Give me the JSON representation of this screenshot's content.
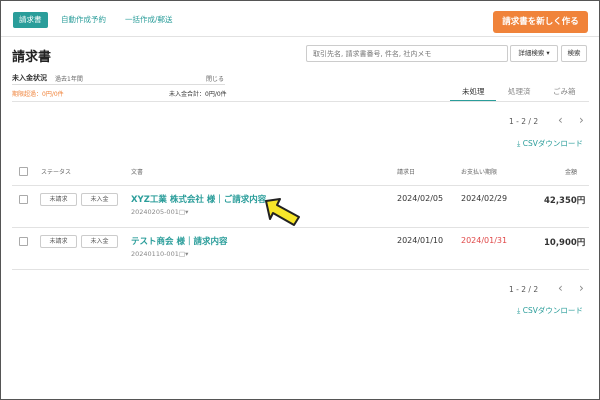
{
  "tabs": [
    {
      "label": "請求書"
    },
    {
      "label": "自動作成予約"
    },
    {
      "label": "一括作成/郵送"
    }
  ],
  "primary_button": "請求書を新しく作る",
  "page_title": "請求書",
  "search": {
    "placeholder": "取引先名, 請求書番号, 件名, 社内メモ",
    "detail_button": "詳細検索",
    "detail_caret": "▾",
    "search_button": "検索"
  },
  "unpaid_status": {
    "label": "未入金状況",
    "period": "過去1年間",
    "close_label": "閉じる",
    "overdue": "期限超過：0円/0件",
    "unpaid_total": "未入金合計：0円/0件"
  },
  "filter_tabs": [
    {
      "label": "未処理"
    },
    {
      "label": "処理済"
    },
    {
      "label": "ごみ箱"
    }
  ],
  "pagination": {
    "label": "1 - 2 / 2",
    "prev": "‹",
    "next": "›"
  },
  "csv_download": {
    "icon": "⤓",
    "label": "CSVダウンロード"
  },
  "table": {
    "headers": {
      "status": "ステータス",
      "document": "文書",
      "invoice_date": "請求日",
      "due_date": "お支払い期限",
      "amount": "金額"
    },
    "rows": [
      {
        "status1": "未請求",
        "status2": "未入金",
        "title": "XYZ工業 株式会社 様｜ご請求内容",
        "number": "20240205-001",
        "memo_icon": "□▾",
        "invoice_date": "2024/02/05",
        "due_date": "2024/02/29",
        "due_overdue": false,
        "amount": "42,350円"
      },
      {
        "status1": "未請求",
        "status2": "未入金",
        "title": "テスト商会 様｜請求内容",
        "number": "20240110-001",
        "memo_icon": "□▾",
        "invoice_date": "2024/01/10",
        "due_date": "2024/01/31",
        "due_overdue": true,
        "amount": "10,900円"
      }
    ]
  },
  "colors": {
    "accent": "#2a9d9a",
    "primary": "#f0833a",
    "overdue": "#e04848",
    "pointer": "#f7e62a"
  }
}
